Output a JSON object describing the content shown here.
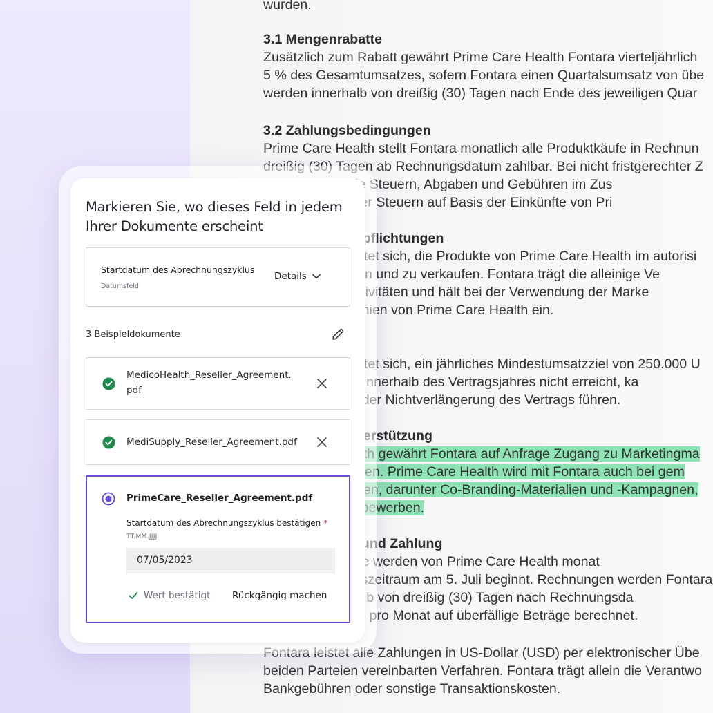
{
  "document": {
    "line_top": "wurden.",
    "s31_heading": "3.1 Mengenrabatte",
    "s31_lines": [
      "Zusätzlich zum Rabatt gewährt Prime Care Health Fontara vierteljährlich",
      "5 % des Gesamtumsatzes, sofern Fontara einen Quartalsumsatz von übe",
      "werden innerhalb von dreißig (30) Tagen nach Ende des jeweiligen Quar"
    ],
    "s32_heading": "3.2 Zahlungsbedingungen",
    "s32_lines": [
      "Prime Care Health stellt Fontara monatlich alle Produktkäufe in Rechnun",
      "dreißig (30) Tagen ab Rechnungsdatum zahlbar. Bei nicht fristgerechter Z",
      "Fontara trägt alle Steuern, Abgaben und Gebühren im Zus",
      "mit Ausnahme der Steuern auf Basis der Einkünfte von Pri"
    ],
    "s4_heading": "4. Marketingverpflichtungen",
    "s4_lines": [
      "Fontara verpflichtet sich, die Produkte von Prime Care Health im autorisi",
      "aktiv zu bewerben und zu verkaufen. Fontara trägt die alleinige Ve",
      "für alle Werbeaktivitäten und hält bei der Verwendung der Marke",
      "die Markenrichtlinien von Prime Care Health ein."
    ],
    "s5_lines": [
      "Fontara verpflichtet sich, ein jährliches Mindestumsatzziel von 250.000 U",
      "Wird dieses Ziel innerhalb des Vertragsjahres nicht erreicht, ka",
      "zur Kündigung oder Nichtverlängerung des Vertrags führen."
    ],
    "s6_heading": "6. Marketingunterstützung",
    "s6_lines": [
      "Prime Care Health gewährt Fontara auf Anfrage Zugang zu Marketingma",
      "Verkaufsunterlagen. Prime Care Health wird mit Fontara auch bei gem",
      "zusammenarbeiten, darunter Co-Branding-Materialien und -Kampagnen,",
      "die Produkte zu bewerben."
    ],
    "s7_heading": "7. Abrechnung und Zahlung",
    "s7_lines": [
      "Alle Produktkäufe werden von Prime Care Health monat",
      "Der Abrechnungszeitraum am 5. Juli beginnt. Rechnungen werden Fontara s",
      "und sind innerhalb von dreißig (30) Tagen nach Rechnungsda",
      "Es werden 1,5 % pro Monat auf überfällige Beträge berechnet."
    ],
    "s8_lines": [
      "Fontara leistet alle Zahlungen in US-Dollar (USD) per elektronischer Übe",
      "beiden Parteien vereinbarten Verfahren. Fontara trägt allein die Verantwo",
      "Bankgebühren oder sonstige Transaktionskosten."
    ]
  },
  "panel": {
    "title": "Markieren Sie, wo dieses Feld in jedem Ihrer Dokumente erscheint",
    "field": {
      "name": "Startdatum des Abrechnungszyklus",
      "type": "Datumsfeld",
      "details_label": "Details"
    },
    "samples_label": "3 Beispieldokumente",
    "documents": [
      {
        "name": "MedicoHealth_Reseller_Agreement.pdf",
        "status": "confirmed"
      },
      {
        "name": "MediSupply_Reseller_Agreement.pdf",
        "status": "confirmed"
      }
    ],
    "active_document": {
      "name": "PrimeCare_Reseller_Agreement.pdf",
      "confirm_label": "Startdatum des Abrechnungszyklus bestätigen",
      "required_mark": "*",
      "format_hint": "TT.MM.JJJJ",
      "date_value": "07/05/2023",
      "confirmed_text": "Wert bestätigt",
      "undo_label": "Rückgängig machen"
    }
  },
  "colors": {
    "accent": "#6a4bdc",
    "success": "#1e8a4c",
    "highlight": "#8de3b4",
    "required": "#d5293d"
  }
}
